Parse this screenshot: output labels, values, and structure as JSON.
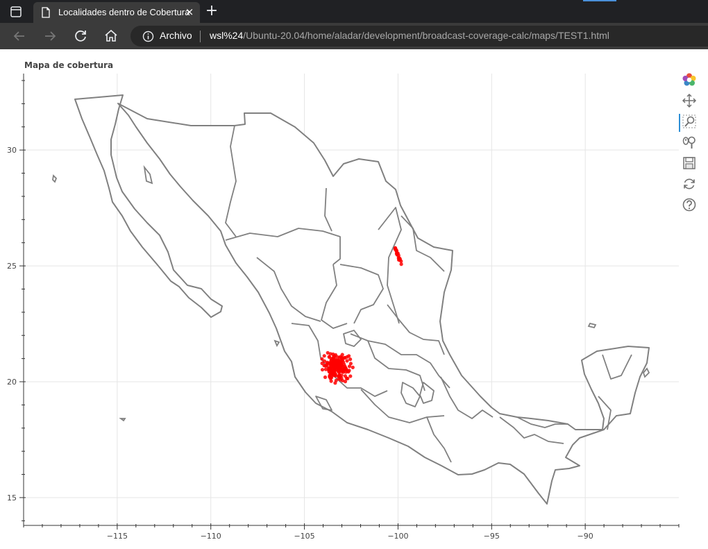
{
  "browser": {
    "tab_title": "Localidades dentro de Cobertura",
    "tab_close": "×",
    "new_tab": "+",
    "address_label": "Archivo",
    "url_host": "wsl%24",
    "url_path": "/Ubuntu-20.04/home/aladar/development/broadcast-coverage-calc/maps/TEST1.html"
  },
  "plot": {
    "title": "Mapa de cobertura",
    "toolbar": [
      "bokeh-logo-icon",
      "pan-icon",
      "box-zoom-icon",
      "wheel-zoom-icon",
      "save-icon",
      "reset-icon",
      "help-icon"
    ],
    "active_tool": "pan-icon"
  },
  "chart_data": {
    "type": "scatter",
    "title": "Mapa de cobertura",
    "xlabel": "",
    "ylabel": "",
    "xlim": [
      -120,
      -85
    ],
    "ylim": [
      13.8,
      33.3
    ],
    "xticks": [
      -115,
      -110,
      -105,
      -100,
      -95,
      -90
    ],
    "xtick_labels": [
      "−115",
      "−110",
      "−105",
      "−100",
      "−95",
      "−90"
    ],
    "yticks": [
      15,
      20,
      25,
      30
    ],
    "grid": true,
    "legend": "none",
    "colors": {
      "points": "#ff0000",
      "boundaries": "#808080",
      "grid": "#e5e5e5"
    },
    "series": [
      {
        "marker": "circle",
        "clusters": [
          {
            "lon": -103.3,
            "lat": 20.65,
            "spread_lon": 0.6,
            "spread_lat": 0.45,
            "n": 220
          },
          {
            "lon": -100.0,
            "lat": 25.45,
            "spread_lon": 0.25,
            "spread_lat": 0.4,
            "n": 25
          }
        ]
      }
    ]
  }
}
